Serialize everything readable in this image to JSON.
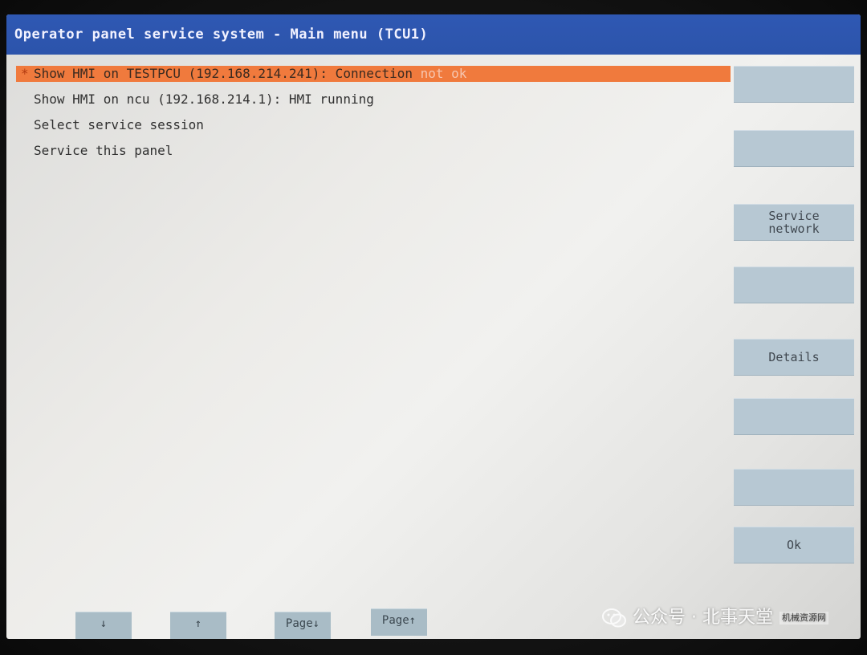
{
  "window": {
    "title": "Operator panel service system - Main menu (TCU1)"
  },
  "menu": {
    "items": [
      {
        "marker": "*",
        "prefix": "Show HMI on TESTPCU (192.168.214.241): Connection ",
        "status": "not ok"
      },
      {
        "label": "Show HMI on ncu (192.168.214.1): HMI running"
      },
      {
        "label": "Select service session"
      },
      {
        "label": "Service this panel"
      }
    ]
  },
  "softkeys": [
    "",
    "",
    "Service\nnetwork",
    "",
    "Details",
    "",
    "",
    "Ok"
  ],
  "bottom_keys": [
    "↓",
    "↑",
    "Page↓",
    "Page↑"
  ],
  "watermark": {
    "text": "公众号 · 北事天堂",
    "logo": "机械资源网"
  },
  "colors": {
    "titlebar": "#2f58b3",
    "selection": "#f07a3d",
    "softkey": "#b7c8d3"
  }
}
